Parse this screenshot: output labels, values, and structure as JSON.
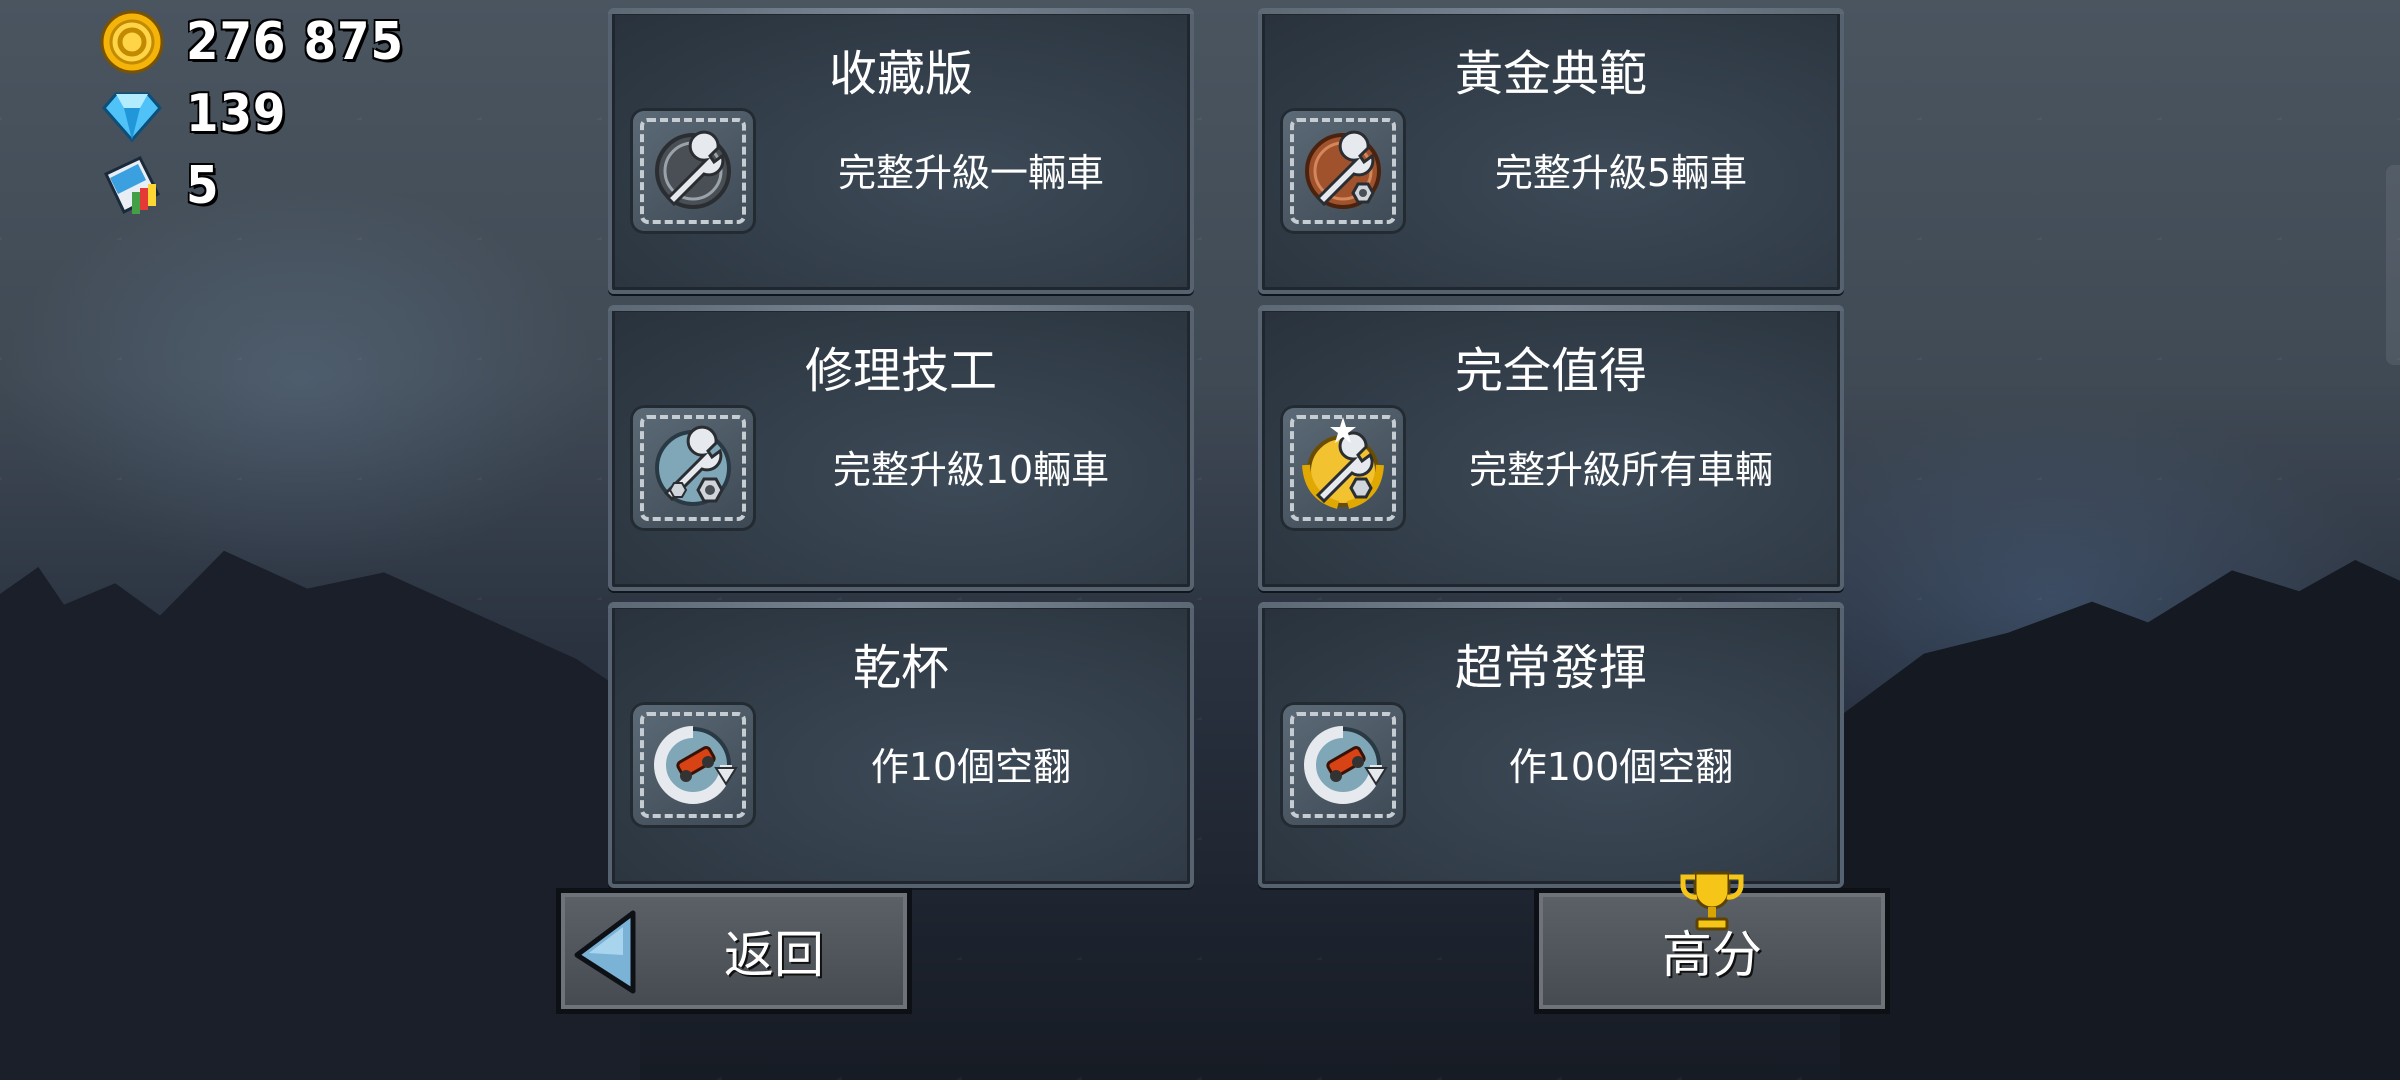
{
  "hud": {
    "coins": "276 875",
    "gems": "139",
    "tickets": "5"
  },
  "icons": {
    "coin": "coin-icon",
    "gem": "gem-icon",
    "ticket": "paint-ticket-icon"
  },
  "achievements": [
    {
      "title": "收藏版",
      "desc": "完整升級一輛車",
      "icon": "wrench-silver-badge-icon"
    },
    {
      "title": "黃金典範",
      "desc": "完整升級5輛車",
      "icon": "wrench-bronze-badge-icon"
    },
    {
      "title": "修理技工",
      "desc": "完整升級10輛車",
      "icon": "wrench-nut-icon"
    },
    {
      "title": "完全值得",
      "desc": "完整升級所有車輛",
      "icon": "wrench-gold-laurel-icon"
    },
    {
      "title": "乾杯",
      "desc": "作10個空翻",
      "icon": "flip-car-icon"
    },
    {
      "title": "超常發揮",
      "desc": "作100個空翻",
      "icon": "flip-car-icon"
    }
  ],
  "buttons": {
    "back": "返回",
    "highscore": "高分"
  },
  "colors": {
    "coin_gold": "#f5b40a",
    "gem_blue": "#4fc3f7",
    "card_bg": "#2e3944",
    "button_bg": "#4e5459"
  }
}
